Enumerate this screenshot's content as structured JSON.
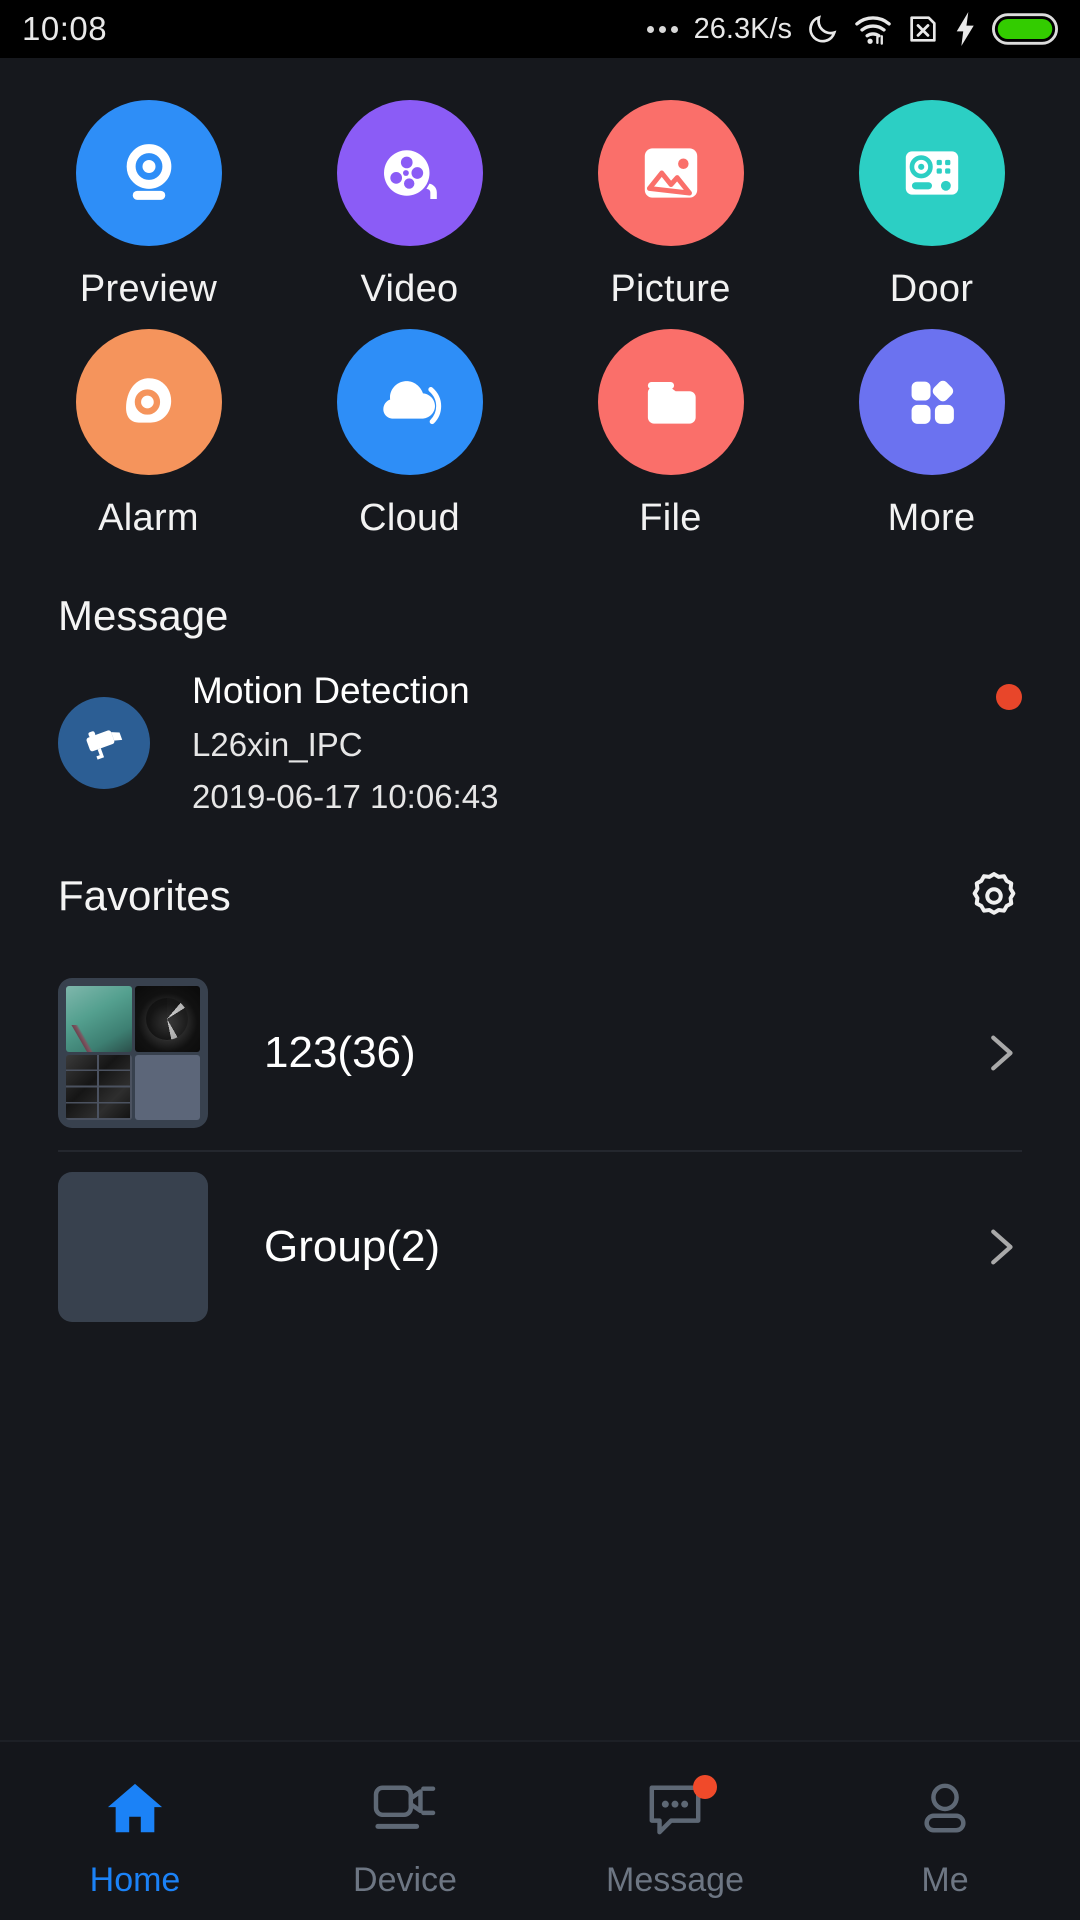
{
  "statusbar": {
    "time": "10:08",
    "network_speed": "26.3K/s",
    "icons": [
      "more-dots-icon",
      "moon-icon",
      "wifi-icon",
      "sim-card-off-icon",
      "charging-bolt-icon",
      "battery-icon"
    ],
    "battery_color": "#33cc00"
  },
  "grid": {
    "items": [
      {
        "label": "Preview",
        "icon": "webcam-icon",
        "color": "#2e8ef7"
      },
      {
        "label": "Video",
        "icon": "film-reel-icon",
        "color": "#8b5cf6"
      },
      {
        "label": "Picture",
        "icon": "image-icon",
        "color": "#fa6f6a"
      },
      {
        "label": "Door",
        "icon": "doorbell-panel-icon",
        "color": "#2ccfc4"
      },
      {
        "label": "Alarm",
        "icon": "alarm-eye-icon",
        "color": "#f5945c"
      },
      {
        "label": "Cloud",
        "icon": "cloud-icon",
        "color": "#2e8ef7"
      },
      {
        "label": "File",
        "icon": "folder-icon",
        "color": "#fa6f6a"
      },
      {
        "label": "More",
        "icon": "grid-apps-icon",
        "color": "#6b72f0"
      }
    ]
  },
  "message": {
    "section_title": "Message",
    "item": {
      "icon": "cctv-camera-icon",
      "title": "Motion Detection",
      "device": "L26xin_IPC",
      "timestamp": "2019-06-17 10:06:43",
      "unread_dot": true,
      "unread_color": "#e8462a"
    }
  },
  "favorites": {
    "section_title": "Favorites",
    "settings_icon": "gear-icon",
    "items": [
      {
        "name": "123(36)",
        "thumb_icon": "camera-grid-thumbnail",
        "chevron": "chevron-right-icon"
      },
      {
        "name": "Group(2)",
        "thumb_icon": "camera-pair-thumbnail",
        "chevron": "chevron-right-icon"
      }
    ]
  },
  "tabbar": {
    "active_color": "#1b82f7",
    "inactive_color": "#6d7683",
    "tabs": [
      {
        "label": "Home",
        "icon": "home-icon",
        "active": true,
        "badge": false
      },
      {
        "label": "Device",
        "icon": "video-device-icon",
        "active": false,
        "badge": false
      },
      {
        "label": "Message",
        "icon": "chat-bubble-icon",
        "active": false,
        "badge": true
      },
      {
        "label": "Me",
        "icon": "person-icon",
        "active": false,
        "badge": false
      }
    ]
  }
}
